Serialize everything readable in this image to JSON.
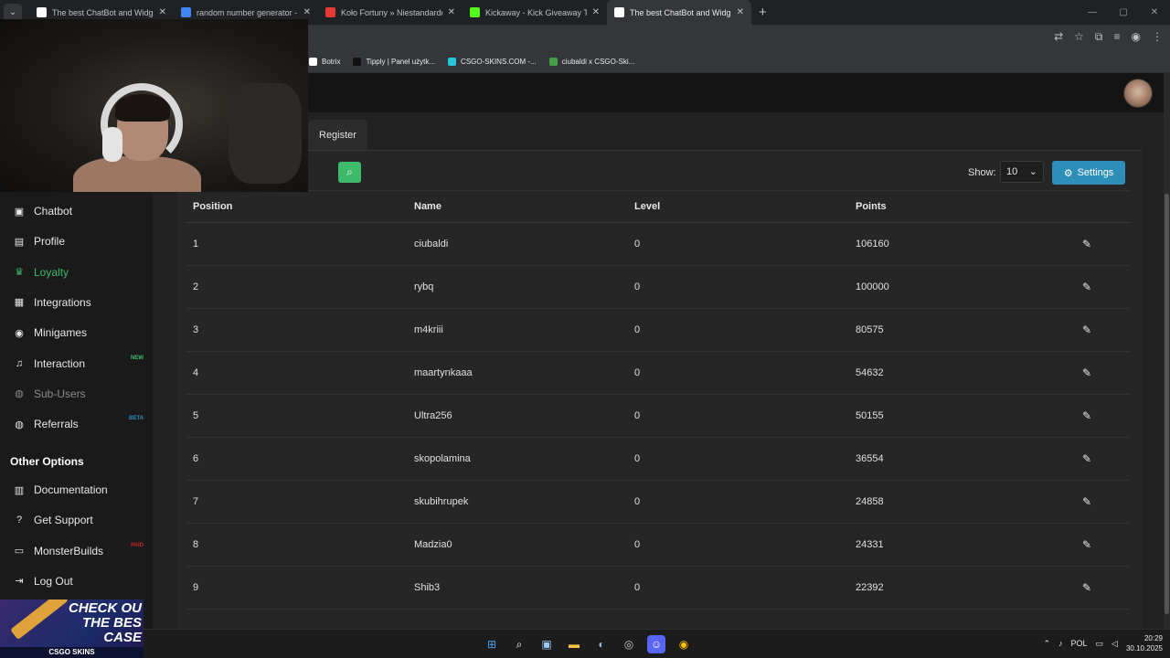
{
  "browser": {
    "tabs": [
      {
        "title": "The best ChatBot and Widgets",
        "favicon_color": "#ffffff",
        "active": false
      },
      {
        "title": "random number generator - Sz",
        "favicon_color": "#4285f4",
        "active": false
      },
      {
        "title": "Koło Fortuny » Niestandardowy",
        "favicon_color": "#e53935",
        "active": false
      },
      {
        "title": "Kickaway - Kick Giveaway Tool",
        "favicon_color": "#53fc18",
        "active": false
      },
      {
        "title": "The best ChatBot and Widgets",
        "favicon_color": "#ffffff",
        "active": true
      }
    ],
    "bookmarks": [
      {
        "label": "Botrix",
        "color": "#ffffff"
      },
      {
        "label": "Tipply | Panel użytk...",
        "color": "#111111"
      },
      {
        "label": "CSGO-SKINS.COM -...",
        "color": "#26c6da"
      },
      {
        "label": "ciubaldi x CSGO-Ski...",
        "color": "#43a047"
      }
    ]
  },
  "sidebar": {
    "items": [
      {
        "label": "Chatbot",
        "icon": "robot-icon",
        "glyph": "▣",
        "state": "normal",
        "badge": ""
      },
      {
        "label": "Profile",
        "icon": "id-card-icon",
        "glyph": "▤",
        "state": "normal",
        "badge": ""
      },
      {
        "label": "Loyalty",
        "icon": "trophy-icon",
        "glyph": "♛",
        "state": "active",
        "badge": ""
      },
      {
        "label": "Integrations",
        "icon": "plug-icon",
        "glyph": "▦",
        "state": "normal",
        "badge": ""
      },
      {
        "label": "Minigames",
        "icon": "gamepad-icon",
        "glyph": "◉",
        "state": "normal",
        "badge": ""
      },
      {
        "label": "Interaction",
        "icon": "music-icon",
        "glyph": "♫",
        "state": "normal",
        "badge": "NEW"
      },
      {
        "label": "Sub-Users",
        "icon": "users-icon",
        "glyph": "◍",
        "state": "muted",
        "badge": ""
      },
      {
        "label": "Referrals",
        "icon": "users-icon",
        "glyph": "◍",
        "state": "normal",
        "badge": "BETA"
      }
    ],
    "other_heading": "Other Options",
    "other_items": [
      {
        "label": "Documentation",
        "icon": "book-icon",
        "glyph": "▥",
        "badge": ""
      },
      {
        "label": "Get Support",
        "icon": "question-icon",
        "glyph": "?",
        "badge": ""
      },
      {
        "label": "MonsterBuilds",
        "icon": "laptop-icon",
        "glyph": "▭",
        "badge": "PAID"
      },
      {
        "label": "Log Out",
        "icon": "logout-icon",
        "glyph": "⇥",
        "badge": ""
      }
    ],
    "promo": {
      "line1": "CHECK OU",
      "line2": "THE BES",
      "line3": "CASE",
      "brand": "CSGO SKINS"
    }
  },
  "main": {
    "subtab_label": "Register",
    "show_label": "Show:",
    "show_value": "10",
    "settings_label": "Settings",
    "table": {
      "headers": [
        "Position",
        "Name",
        "Level",
        "Points"
      ],
      "rows": [
        [
          "1",
          "ciubaldi",
          "0",
          "106160"
        ],
        [
          "2",
          "rybq",
          "0",
          "100000"
        ],
        [
          "3",
          "m4kriii",
          "0",
          "80575"
        ],
        [
          "4",
          "maartynkaaa",
          "0",
          "54632"
        ],
        [
          "5",
          "Ultra256",
          "0",
          "50155"
        ],
        [
          "6",
          "skopolamina",
          "0",
          "36554"
        ],
        [
          "7",
          "skubihrupek",
          "0",
          "24858"
        ],
        [
          "8",
          "Madzia0",
          "0",
          "24331"
        ],
        [
          "9",
          "Shib3",
          "0",
          "22392"
        ]
      ]
    }
  },
  "taskbar": {
    "lang": "POL",
    "time": "20:29",
    "date": "30.10.2025"
  },
  "colors": {
    "accent_green": "#3dbb6a",
    "settings_blue": "#2d8fb8",
    "badge_new": "#3dbb6a",
    "badge_beta": "#2d8fb8",
    "badge_paid": "#c62828"
  }
}
